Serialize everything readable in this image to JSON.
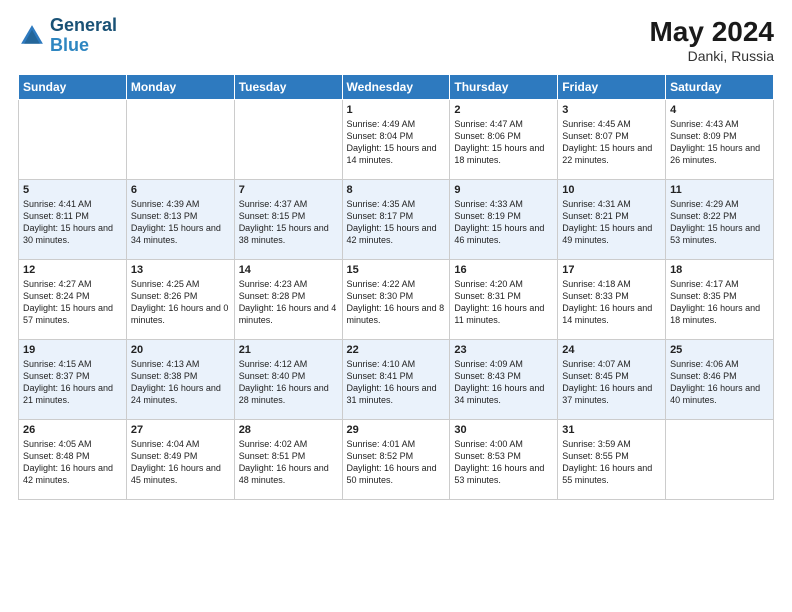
{
  "header": {
    "logo_line1": "General",
    "logo_line2": "Blue",
    "month_year": "May 2024",
    "location": "Danki, Russia"
  },
  "days_of_week": [
    "Sunday",
    "Monday",
    "Tuesday",
    "Wednesday",
    "Thursday",
    "Friday",
    "Saturday"
  ],
  "weeks": [
    [
      {
        "day": "",
        "sunrise": "",
        "sunset": "",
        "daylight": ""
      },
      {
        "day": "",
        "sunrise": "",
        "sunset": "",
        "daylight": ""
      },
      {
        "day": "",
        "sunrise": "",
        "sunset": "",
        "daylight": ""
      },
      {
        "day": "1",
        "sunrise": "Sunrise: 4:49 AM",
        "sunset": "Sunset: 8:04 PM",
        "daylight": "Daylight: 15 hours and 14 minutes."
      },
      {
        "day": "2",
        "sunrise": "Sunrise: 4:47 AM",
        "sunset": "Sunset: 8:06 PM",
        "daylight": "Daylight: 15 hours and 18 minutes."
      },
      {
        "day": "3",
        "sunrise": "Sunrise: 4:45 AM",
        "sunset": "Sunset: 8:07 PM",
        "daylight": "Daylight: 15 hours and 22 minutes."
      },
      {
        "day": "4",
        "sunrise": "Sunrise: 4:43 AM",
        "sunset": "Sunset: 8:09 PM",
        "daylight": "Daylight: 15 hours and 26 minutes."
      }
    ],
    [
      {
        "day": "5",
        "sunrise": "Sunrise: 4:41 AM",
        "sunset": "Sunset: 8:11 PM",
        "daylight": "Daylight: 15 hours and 30 minutes."
      },
      {
        "day": "6",
        "sunrise": "Sunrise: 4:39 AM",
        "sunset": "Sunset: 8:13 PM",
        "daylight": "Daylight: 15 hours and 34 minutes."
      },
      {
        "day": "7",
        "sunrise": "Sunrise: 4:37 AM",
        "sunset": "Sunset: 8:15 PM",
        "daylight": "Daylight: 15 hours and 38 minutes."
      },
      {
        "day": "8",
        "sunrise": "Sunrise: 4:35 AM",
        "sunset": "Sunset: 8:17 PM",
        "daylight": "Daylight: 15 hours and 42 minutes."
      },
      {
        "day": "9",
        "sunrise": "Sunrise: 4:33 AM",
        "sunset": "Sunset: 8:19 PM",
        "daylight": "Daylight: 15 hours and 46 minutes."
      },
      {
        "day": "10",
        "sunrise": "Sunrise: 4:31 AM",
        "sunset": "Sunset: 8:21 PM",
        "daylight": "Daylight: 15 hours and 49 minutes."
      },
      {
        "day": "11",
        "sunrise": "Sunrise: 4:29 AM",
        "sunset": "Sunset: 8:22 PM",
        "daylight": "Daylight: 15 hours and 53 minutes."
      }
    ],
    [
      {
        "day": "12",
        "sunrise": "Sunrise: 4:27 AM",
        "sunset": "Sunset: 8:24 PM",
        "daylight": "Daylight: 15 hours and 57 minutes."
      },
      {
        "day": "13",
        "sunrise": "Sunrise: 4:25 AM",
        "sunset": "Sunset: 8:26 PM",
        "daylight": "Daylight: 16 hours and 0 minutes."
      },
      {
        "day": "14",
        "sunrise": "Sunrise: 4:23 AM",
        "sunset": "Sunset: 8:28 PM",
        "daylight": "Daylight: 16 hours and 4 minutes."
      },
      {
        "day": "15",
        "sunrise": "Sunrise: 4:22 AM",
        "sunset": "Sunset: 8:30 PM",
        "daylight": "Daylight: 16 hours and 8 minutes."
      },
      {
        "day": "16",
        "sunrise": "Sunrise: 4:20 AM",
        "sunset": "Sunset: 8:31 PM",
        "daylight": "Daylight: 16 hours and 11 minutes."
      },
      {
        "day": "17",
        "sunrise": "Sunrise: 4:18 AM",
        "sunset": "Sunset: 8:33 PM",
        "daylight": "Daylight: 16 hours and 14 minutes."
      },
      {
        "day": "18",
        "sunrise": "Sunrise: 4:17 AM",
        "sunset": "Sunset: 8:35 PM",
        "daylight": "Daylight: 16 hours and 18 minutes."
      }
    ],
    [
      {
        "day": "19",
        "sunrise": "Sunrise: 4:15 AM",
        "sunset": "Sunset: 8:37 PM",
        "daylight": "Daylight: 16 hours and 21 minutes."
      },
      {
        "day": "20",
        "sunrise": "Sunrise: 4:13 AM",
        "sunset": "Sunset: 8:38 PM",
        "daylight": "Daylight: 16 hours and 24 minutes."
      },
      {
        "day": "21",
        "sunrise": "Sunrise: 4:12 AM",
        "sunset": "Sunset: 8:40 PM",
        "daylight": "Daylight: 16 hours and 28 minutes."
      },
      {
        "day": "22",
        "sunrise": "Sunrise: 4:10 AM",
        "sunset": "Sunset: 8:41 PM",
        "daylight": "Daylight: 16 hours and 31 minutes."
      },
      {
        "day": "23",
        "sunrise": "Sunrise: 4:09 AM",
        "sunset": "Sunset: 8:43 PM",
        "daylight": "Daylight: 16 hours and 34 minutes."
      },
      {
        "day": "24",
        "sunrise": "Sunrise: 4:07 AM",
        "sunset": "Sunset: 8:45 PM",
        "daylight": "Daylight: 16 hours and 37 minutes."
      },
      {
        "day": "25",
        "sunrise": "Sunrise: 4:06 AM",
        "sunset": "Sunset: 8:46 PM",
        "daylight": "Daylight: 16 hours and 40 minutes."
      }
    ],
    [
      {
        "day": "26",
        "sunrise": "Sunrise: 4:05 AM",
        "sunset": "Sunset: 8:48 PM",
        "daylight": "Daylight: 16 hours and 42 minutes."
      },
      {
        "day": "27",
        "sunrise": "Sunrise: 4:04 AM",
        "sunset": "Sunset: 8:49 PM",
        "daylight": "Daylight: 16 hours and 45 minutes."
      },
      {
        "day": "28",
        "sunrise": "Sunrise: 4:02 AM",
        "sunset": "Sunset: 8:51 PM",
        "daylight": "Daylight: 16 hours and 48 minutes."
      },
      {
        "day": "29",
        "sunrise": "Sunrise: 4:01 AM",
        "sunset": "Sunset: 8:52 PM",
        "daylight": "Daylight: 16 hours and 50 minutes."
      },
      {
        "day": "30",
        "sunrise": "Sunrise: 4:00 AM",
        "sunset": "Sunset: 8:53 PM",
        "daylight": "Daylight: 16 hours and 53 minutes."
      },
      {
        "day": "31",
        "sunrise": "Sunrise: 3:59 AM",
        "sunset": "Sunset: 8:55 PM",
        "daylight": "Daylight: 16 hours and 55 minutes."
      },
      {
        "day": "",
        "sunrise": "",
        "sunset": "",
        "daylight": ""
      }
    ]
  ]
}
